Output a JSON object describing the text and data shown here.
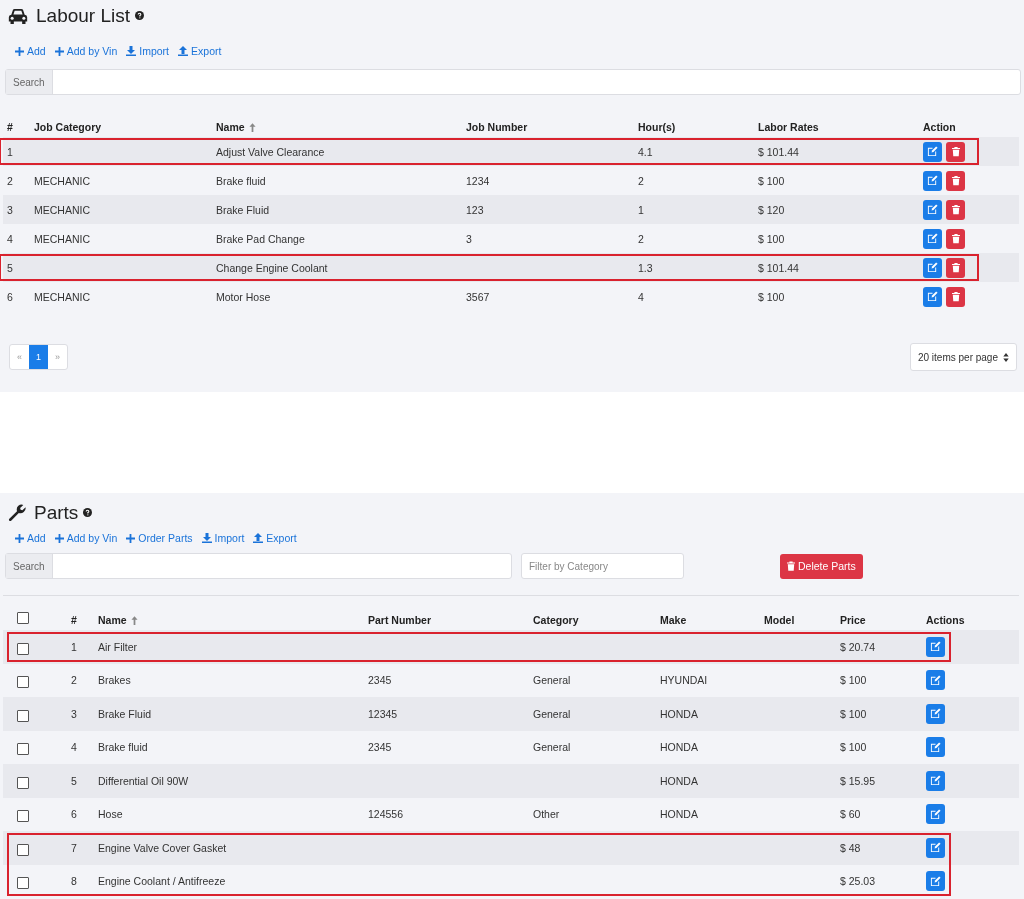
{
  "labour": {
    "title": "Labour List",
    "toolbar": [
      {
        "kind": "add",
        "label": "Add"
      },
      {
        "kind": "add",
        "label": "Add by Vin"
      },
      {
        "kind": "import",
        "label": "Import"
      },
      {
        "kind": "export",
        "label": "Export"
      }
    ],
    "search": {
      "label": "Search"
    },
    "columns": [
      {
        "label": "#",
        "sorted": false
      },
      {
        "label": "Job Category",
        "sorted": false
      },
      {
        "label": "Name",
        "sorted": true
      },
      {
        "label": "Job Number",
        "sorted": false
      },
      {
        "label": "Hour(s)",
        "sorted": false
      },
      {
        "label": "Labor Rates",
        "sorted": false
      },
      {
        "label": "Action",
        "sorted": false
      }
    ],
    "rows": [
      {
        "num": "1",
        "category": "",
        "name": "Adjust Valve Clearance",
        "job_number": "",
        "hours": "4.1",
        "rate": "$ 101.44",
        "highlighted": true
      },
      {
        "num": "2",
        "category": "MECHANIC",
        "name": "Brake fluid",
        "job_number": "1234",
        "hours": "2",
        "rate": "$ 100",
        "highlighted": false
      },
      {
        "num": "3",
        "category": "MECHANIC",
        "name": "Brake Fluid",
        "job_number": "123",
        "hours": "1",
        "rate": "$ 120",
        "highlighted": false
      },
      {
        "num": "4",
        "category": "MECHANIC",
        "name": "Brake Pad Change",
        "job_number": "3",
        "hours": "2",
        "rate": "$ 100",
        "highlighted": false
      },
      {
        "num": "5",
        "category": "",
        "name": "Change Engine Coolant",
        "job_number": "",
        "hours": "1.3",
        "rate": "$ 101.44",
        "highlighted": true
      },
      {
        "num": "6",
        "category": "MECHANIC",
        "name": "Motor Hose",
        "job_number": "3567",
        "hours": "4",
        "rate": "$ 100",
        "highlighted": false
      }
    ],
    "pagination": {
      "prev": "«",
      "pages": [
        {
          "label": "1",
          "selected": true
        }
      ],
      "next": "»"
    },
    "page_size": "20 items per page"
  },
  "parts": {
    "title": "Parts",
    "toolbar": [
      {
        "kind": "add",
        "label": "Add"
      },
      {
        "kind": "add",
        "label": "Add by Vin"
      },
      {
        "kind": "add",
        "label": "Order Parts"
      },
      {
        "kind": "import",
        "label": "Import"
      },
      {
        "kind": "export",
        "label": "Export"
      }
    ],
    "search": {
      "label": "Search"
    },
    "filter": {
      "placeholder": "Filter by Category"
    },
    "delete_button": "Delete Parts",
    "select_all": {
      "checked": false
    },
    "columns": [
      {
        "label": "#",
        "sorted": false
      },
      {
        "label": "Name",
        "sorted": true
      },
      {
        "label": "Part Number",
        "sorted": false
      },
      {
        "label": "Category",
        "sorted": false
      },
      {
        "label": "Make",
        "sorted": false
      },
      {
        "label": "Model",
        "sorted": false
      },
      {
        "label": "Price",
        "sorted": false
      },
      {
        "label": "Actions",
        "sorted": false
      }
    ],
    "rows": [
      {
        "checked": false,
        "num": "1",
        "name": "Air Filter",
        "part_number": "",
        "category": "",
        "make": "",
        "model": "",
        "price": "$ 20.74",
        "highlighted": true
      },
      {
        "checked": false,
        "num": "2",
        "name": "Brakes",
        "part_number": "2345",
        "category": "General",
        "make": "HYUNDAI",
        "model": "",
        "price": "$ 100",
        "highlighted": false
      },
      {
        "checked": false,
        "num": "3",
        "name": "Brake Fluid",
        "part_number": "12345",
        "category": "General",
        "make": "HONDA",
        "model": "",
        "price": "$ 100",
        "highlighted": false
      },
      {
        "checked": false,
        "num": "4",
        "name": "Brake fluid",
        "part_number": "2345",
        "category": "General",
        "make": "HONDA",
        "model": "",
        "price": "$ 100",
        "highlighted": false
      },
      {
        "checked": false,
        "num": "5",
        "name": "Differential Oil 90W",
        "part_number": "",
        "category": "",
        "make": "HONDA",
        "model": "",
        "price": "$ 15.95",
        "highlighted": false
      },
      {
        "checked": false,
        "num": "6",
        "name": "Hose",
        "part_number": "124556",
        "category": "Other",
        "make": "HONDA",
        "model": "",
        "price": "$ 60",
        "highlighted": false
      },
      {
        "checked": false,
        "num": "7",
        "name": "Engine Valve Cover Gasket",
        "part_number": "",
        "category": "",
        "make": "",
        "model": "",
        "price": "$ 48",
        "highlighted": true
      },
      {
        "checked": false,
        "num": "8",
        "name": "Engine Coolant / Antifreeze",
        "part_number": "",
        "category": "",
        "make": "",
        "model": "",
        "price": "$ 25.03",
        "highlighted": true
      }
    ]
  }
}
